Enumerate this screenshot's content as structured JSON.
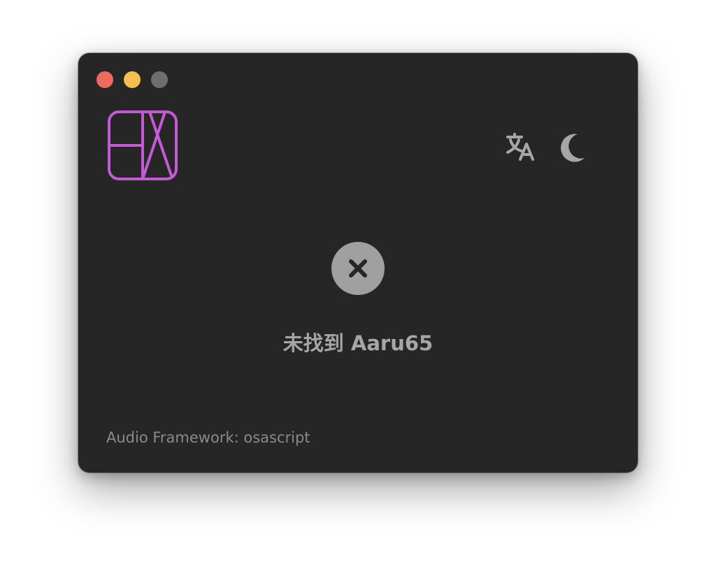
{
  "window": {
    "traffic_lights": [
      {
        "name": "close",
        "color": "#ee6a5e"
      },
      {
        "name": "minimize",
        "color": "#f5be4f"
      },
      {
        "name": "zoom",
        "color": "#6e6e6e"
      }
    ]
  },
  "logo": {
    "icon": "app-logo-icon",
    "color": "#c45ad6"
  },
  "toolbar": {
    "translate_icon": "translate-icon",
    "theme_icon": "moon-icon",
    "icon_color": "#a6a6a6"
  },
  "status": {
    "icon": "close-circle-icon",
    "message": "未找到 Aaru65"
  },
  "footer": {
    "audio_framework": "Audio Framework: osascript"
  }
}
